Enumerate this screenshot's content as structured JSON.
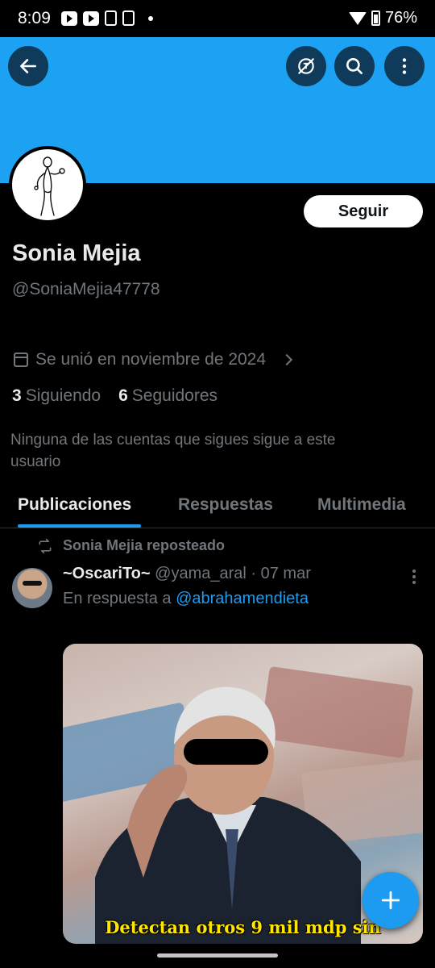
{
  "status_bar": {
    "time": "8:09",
    "battery": "76%",
    "icons_left": [
      "youtube-icon",
      "youtube-icon",
      "phone-icon",
      "app-icon",
      "dot-icon"
    ],
    "icons_right": [
      "wifi-icon",
      "battery-icon"
    ]
  },
  "header": {
    "banner_color": "#1da1f2",
    "buttons": [
      "back-arrow-icon",
      "translate-icon",
      "search-icon",
      "more-vertical-icon"
    ]
  },
  "profile": {
    "follow_label": "Seguir",
    "display_name": "Sonia Mejia",
    "handle": "@SoniaMejia47778",
    "joined": "Se unió en noviembre de 2024",
    "following_count": "3",
    "following_label": "Siguiendo",
    "followers_count": "6",
    "followers_label": "Seguidores",
    "note": "Ninguna de las cuentas que sigues sigue a este usuario"
  },
  "tabs": [
    {
      "label": "Publicaciones",
      "active": true
    },
    {
      "label": "Respuestas",
      "active": false
    },
    {
      "label": "Multimedia",
      "active": false
    }
  ],
  "tweet": {
    "repost_text": "Sonia Mejia reposteado",
    "author_name": "~OscariTo~",
    "author_handle": "@yama_aral",
    "separator": "·",
    "date": "07 mar",
    "reply_prefix": "En respuesta a",
    "reply_mention": "@abrahamendieta",
    "media_caption": "Detectan otros 9 mil mdp sin"
  },
  "fab": {
    "icon": "plus-icon"
  },
  "colors": {
    "accent": "#1d9bf0",
    "background": "#000000",
    "secondary_text": "#71767b"
  }
}
